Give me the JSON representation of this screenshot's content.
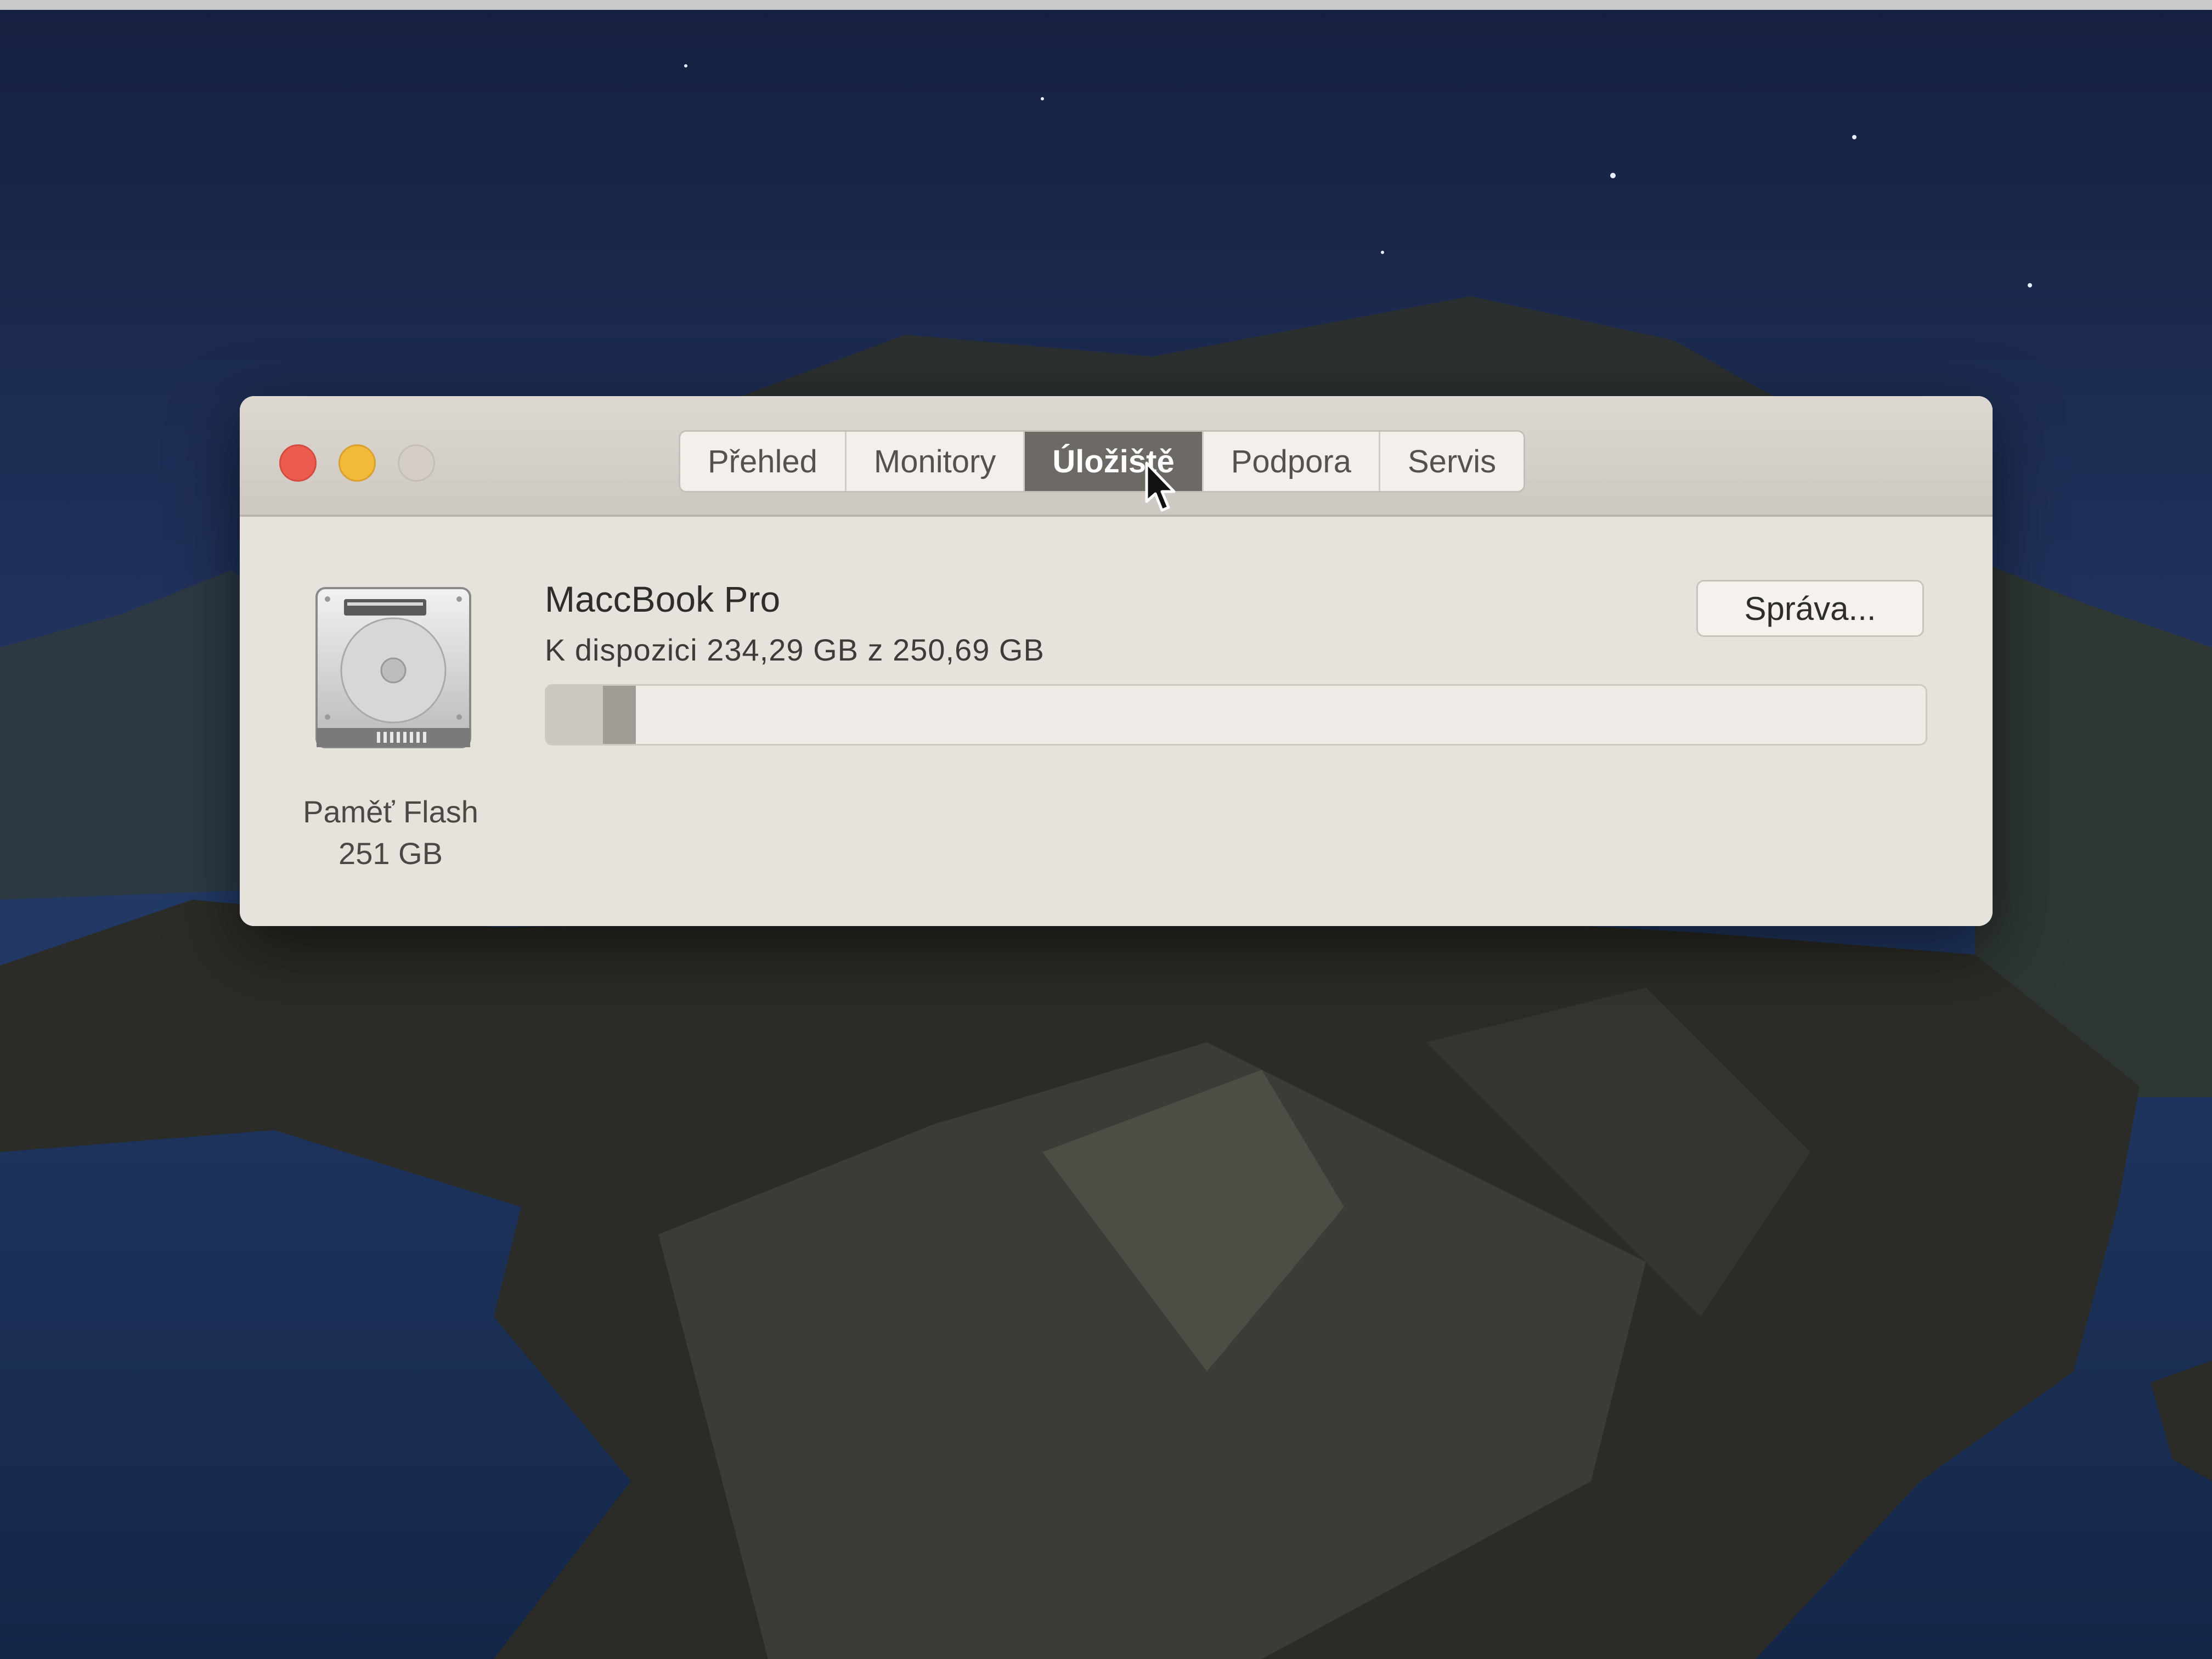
{
  "window": {
    "tabs": [
      {
        "label": "Přehled",
        "active": false
      },
      {
        "label": "Monitory",
        "active": false
      },
      {
        "label": "Úložiště",
        "active": true
      },
      {
        "label": "Podpora",
        "active": false
      },
      {
        "label": "Servis",
        "active": false
      }
    ]
  },
  "storage": {
    "disk": {
      "icon": "hard-drive-icon",
      "type_label": "Paměť Flash",
      "capacity_label": "251 GB"
    },
    "device_name": "MaccBook Pro",
    "availability_text": "K dispozici 234,29 GB z 250,69 GB",
    "manage_button_label": "Správa...",
    "usage": {
      "total_gb": 250.69,
      "available_gb": 234.29,
      "system_fraction": 0.041,
      "other_fraction": 0.024
    }
  },
  "colors": {
    "close": "#ec5b4f",
    "minimize": "#f2b93a",
    "zoom_disabled": "#d4cec7",
    "active_tab": "#6d6a66"
  }
}
